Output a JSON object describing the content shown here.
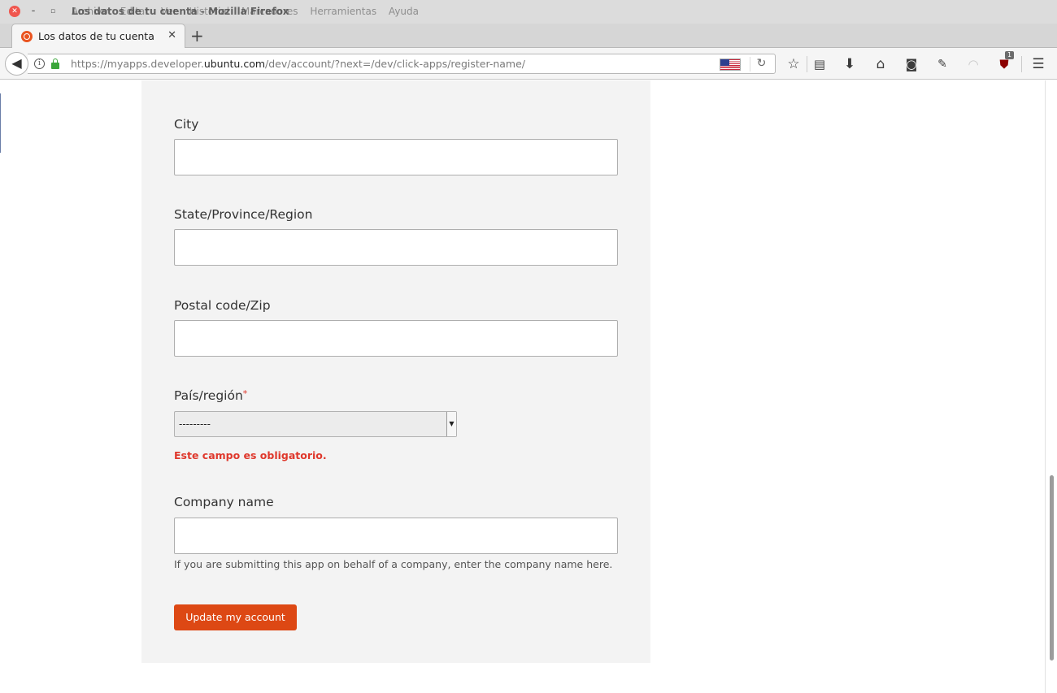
{
  "window": {
    "title": "Los datos de tu cuenta - Mozilla Firefox",
    "menu": [
      "Archivo",
      "Editar",
      "Ver",
      "Historial",
      "Marcadores",
      "Herramientas",
      "Ayuda"
    ]
  },
  "tab": {
    "title": "Los datos de tu cuenta",
    "close_glyph": "✕",
    "new_tab_glyph": "+"
  },
  "address_bar": {
    "url_prefix": "https://myapps.developer.",
    "url_domain": "ubuntu.com",
    "url_path": "/dev/account/?next=/dev/click-apps/register-name/"
  },
  "toolbar": {
    "icons": [
      "star-icon",
      "reading-list-icon",
      "download-icon",
      "home-icon",
      "pocket-icon",
      "evernote-icon",
      "rss-icon",
      "ublock-icon",
      "menu-icon"
    ],
    "ublock_count": "1"
  },
  "form": {
    "city_label": "City",
    "state_label": "State/Province/Region",
    "postal_label": "Postal code/Zip",
    "country_label": "País/región",
    "country_required_mark": "*",
    "country_value": "---------",
    "country_error": "Este campo es obligatorio.",
    "company_label": "Company name",
    "company_help": "If you are submitting this app on behalf of a company, enter the company name here.",
    "submit_label": "Update my account"
  },
  "colors": {
    "accent": "#dd4814",
    "error": "#df382c",
    "panel_bg": "#f3f3f3"
  }
}
